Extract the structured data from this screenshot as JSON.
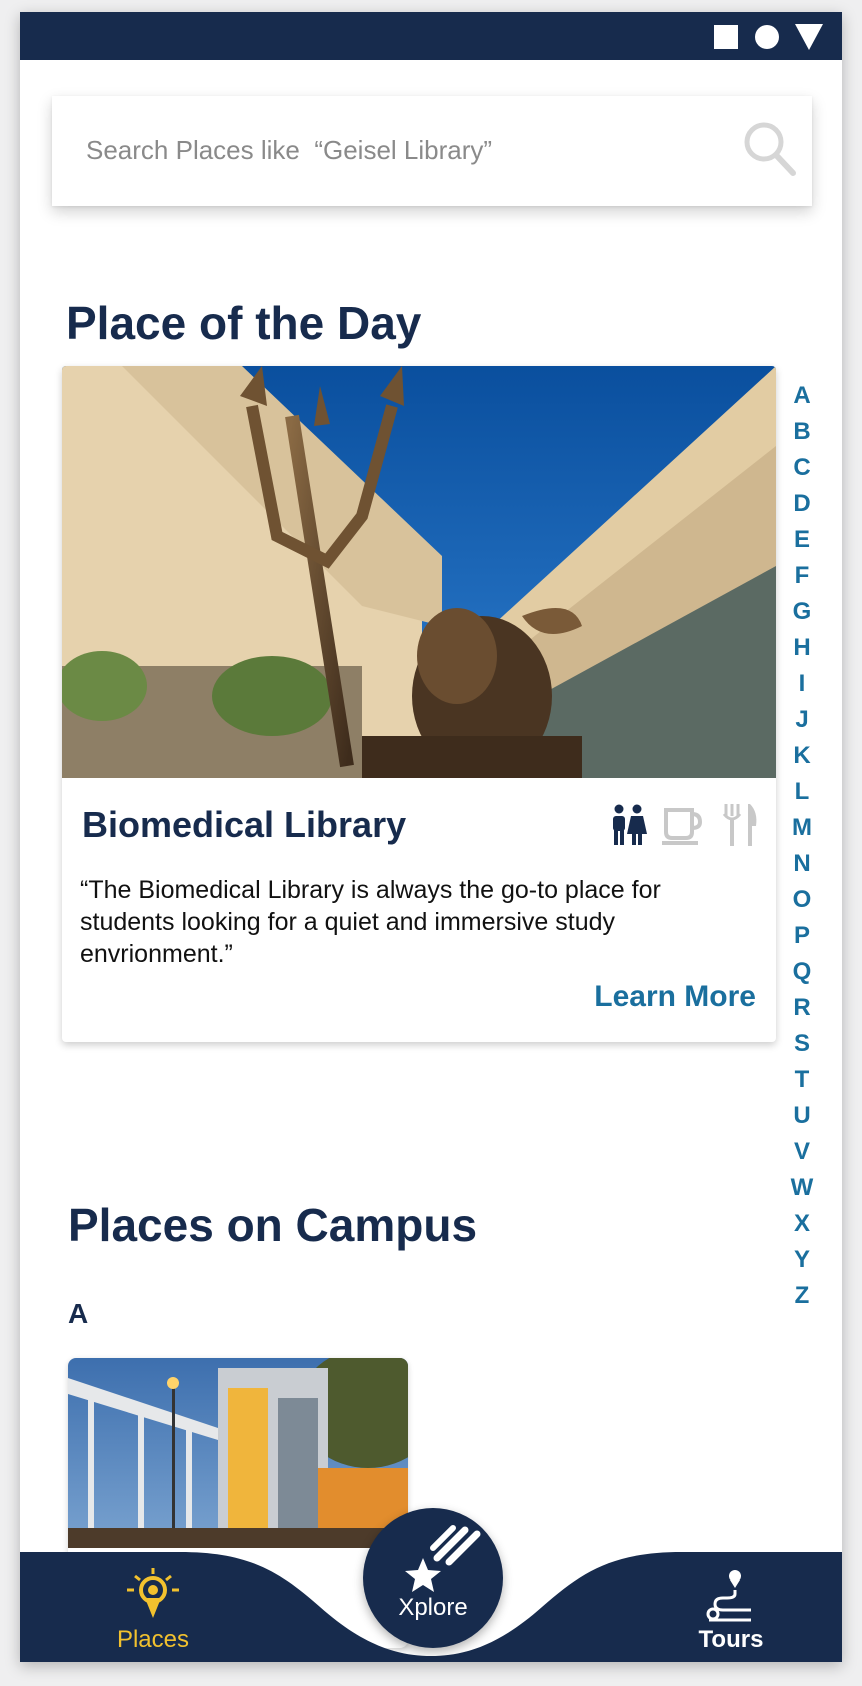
{
  "status_bar": {
    "icons": [
      "square-icon",
      "circle-icon",
      "triangle-icon"
    ]
  },
  "search": {
    "placeholder": "Search Places like  “Geisel Library”",
    "icon": "search-icon"
  },
  "place_of_the_day": {
    "heading": "Place of the Day",
    "place_name": "Biomedical Library",
    "amenity_icons": [
      "restroom-icon",
      "cafe-icon",
      "dining-icon"
    ],
    "quote": "“The Biomedical Library is always the go-to place for students looking for a quiet and immersive study envrionment.”",
    "learn_more_label": "Learn More"
  },
  "az_index": [
    "A",
    "B",
    "C",
    "D",
    "E",
    "F",
    "G",
    "H",
    "I",
    "J",
    "K",
    "L",
    "M",
    "N",
    "O",
    "P",
    "Q",
    "R",
    "S",
    "T",
    "U",
    "V",
    "W",
    "X",
    "Y",
    "Z"
  ],
  "places_on_campus": {
    "heading": "Places on Campus",
    "current_letter": "A"
  },
  "bottom_nav": {
    "places_label": "Places",
    "xplore_label": "Xplore",
    "tours_label": "Tours"
  },
  "colors": {
    "navy": "#172b4d",
    "accent_blue": "#1a6f9e",
    "active_yellow": "#f2c12e",
    "inactive_gray": "#c8c8c8"
  }
}
